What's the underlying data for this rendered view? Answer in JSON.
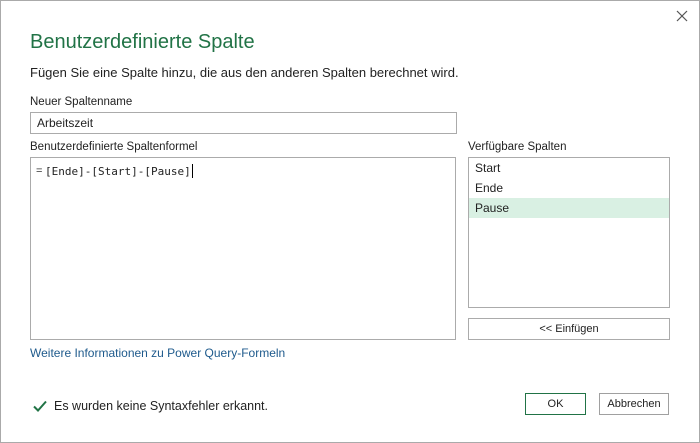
{
  "dialog": {
    "title": "Benutzerdefinierte Spalte",
    "subtitle": "Fügen Sie eine Spalte hinzu, die aus den anderen Spalten berechnet wird.",
    "accent_color": "#217346",
    "close_icon": "close-icon"
  },
  "column_name": {
    "label": "Neuer Spaltenname",
    "value": "Arbeitszeit"
  },
  "formula": {
    "label": "Benutzerdefinierte Spaltenformel",
    "prefix": "=",
    "value": "[Ende]-[Start]-[Pause]"
  },
  "available_columns": {
    "label": "Verfügbare Spalten",
    "items": [
      "Start",
      "Ende",
      "Pause"
    ],
    "selected": "Pause",
    "selected_color": "#d9f0e3"
  },
  "insert_button": {
    "label": "<< Einfügen"
  },
  "help_link": {
    "label": "Weitere Informationen zu Power Query-Formeln",
    "color": "#1e5a8c"
  },
  "status": {
    "icon": "checkmark-icon",
    "text": "Es wurden keine Syntaxfehler erkannt."
  },
  "buttons": {
    "ok": "OK",
    "cancel": "Abbrechen"
  }
}
